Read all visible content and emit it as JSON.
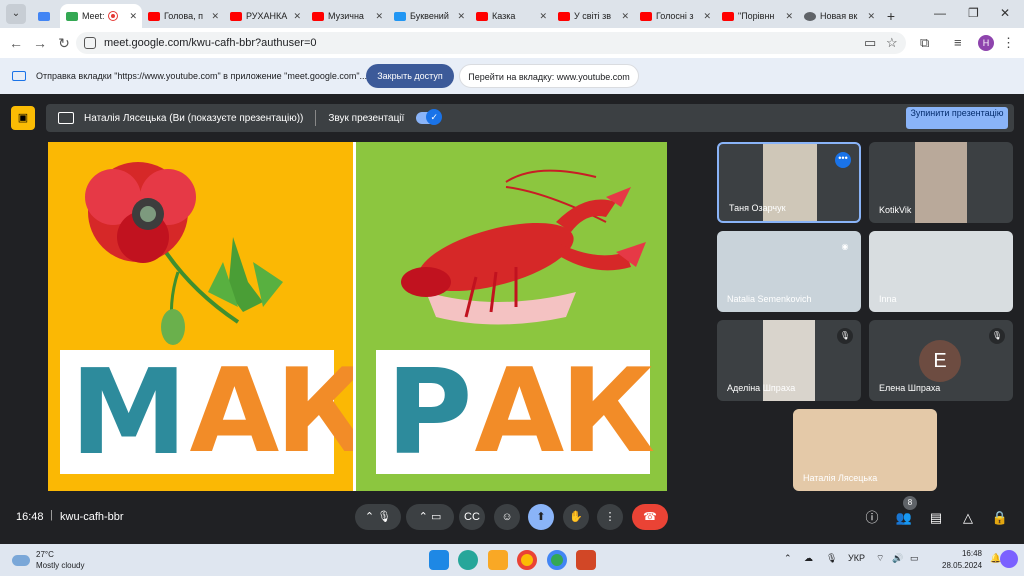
{
  "browser": {
    "tabs": [
      {
        "label": "Meet:",
        "color": "#34a853",
        "active": true
      },
      {
        "label": "Голова, п",
        "color": "#ff0000"
      },
      {
        "label": "РУХАНКА",
        "color": "#ff0000"
      },
      {
        "label": "Музична",
        "color": "#ff0000"
      },
      {
        "label": "Буквений",
        "color": "#2196f3"
      },
      {
        "label": "Казка",
        "color": "#ff0000"
      },
      {
        "label": "У світі зв",
        "color": "#ff0000"
      },
      {
        "label": "Голосні з",
        "color": "#ff0000"
      },
      {
        "label": "\"Порівнн",
        "color": "#ff0000"
      },
      {
        "label": "Новая вк",
        "color": "#5f6368"
      }
    ],
    "url": "meet.google.com/kwu-cafh-bbr?authuser=0",
    "profile_initial": "H"
  },
  "infobar": {
    "message": "Отправка вкладки \"https://www.youtube.com\" в приложение \"meet.google.com\"...",
    "primary_button": "Закрыть доступ",
    "secondary_button": "Перейти на вкладку: www.youtube.com"
  },
  "presenting": {
    "presenter_text": "Наталія Лясецька (Ви (показуєте презентацію))",
    "audio_label": "Звук презентації",
    "stop_button": "Зупинити презентацію"
  },
  "slide": {
    "left_first_letter": "М",
    "left_rest": "АК",
    "right_first_letter": "Р",
    "right_rest": "АК"
  },
  "participants": [
    {
      "name": "Таня Озарчук"
    },
    {
      "name": "KotikVik"
    },
    {
      "name": "Natalia Semenkovich"
    },
    {
      "name": "Inna"
    },
    {
      "name": "Аделіна Шпраха"
    },
    {
      "name": "Елена Шпраха",
      "initial": "Е"
    },
    {
      "name": "Наталія Лясецька"
    }
  ],
  "meeting": {
    "time": "16:48",
    "code": "kwu-cafh-bbr",
    "people_count": "8"
  },
  "taskbar": {
    "temperature": "27°C",
    "weather": "Mostly cloudy",
    "lang": "УКР",
    "time": "16:48",
    "date": "28.05.2024"
  }
}
